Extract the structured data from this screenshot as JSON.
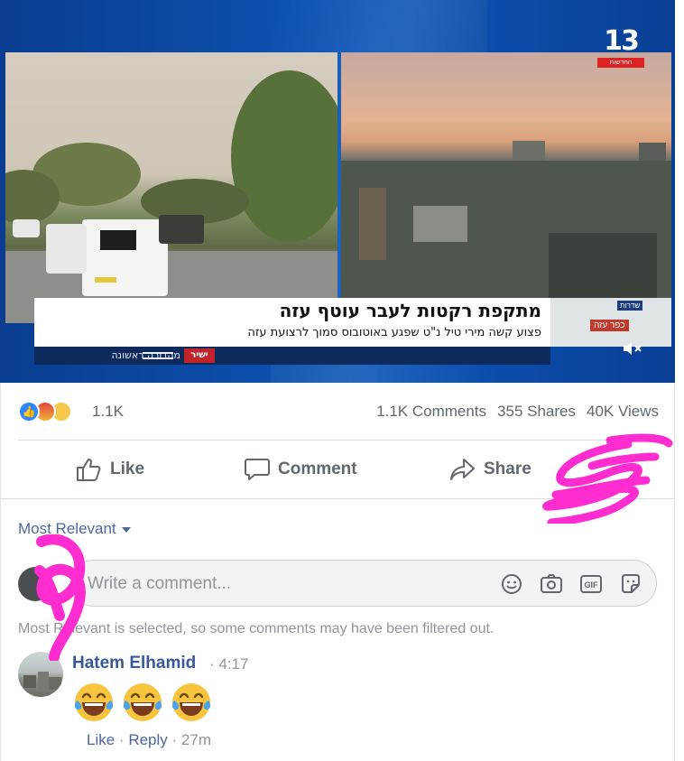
{
  "video": {
    "logo_number": "13",
    "logo_tag": "החדשות",
    "headline": "מתקפת רקטות לעבר עוטף עזה",
    "subheadline": "פצוע קשה מירי טיל נ\"ט שפגע באוטובוס סמוך לרצועת עזה",
    "live_label": "ישיר",
    "edition_label": "מהדורה ראשונה",
    "map_label": "כפר עזה",
    "map_label2": "שדרות"
  },
  "post": {
    "reaction_count": "1.1K",
    "comments": "1.1K Comments",
    "shares": "355 Shares",
    "views": "40K Views",
    "actions": {
      "like": "Like",
      "comment": "Comment",
      "share": "Share"
    },
    "sort_label": "Most Relevant",
    "comment_placeholder": "Write a comment...",
    "filter_notice": "Most Relevant is selected, so some comments may have been filtered out.",
    "comment": {
      "author": "Hatem Elhamid",
      "timestamp": "· 4:17",
      "like": "Like",
      "reply": "Reply",
      "age": "27m",
      "emoji": "face-with-tears-of-joy"
    }
  },
  "colors": {
    "link_blue": "#385898",
    "sort_blue": "#4b67a1",
    "muted_gray": "#90949c",
    "scribble_pink": "#ff2ccf",
    "channel_blue": "#0c56b8"
  }
}
